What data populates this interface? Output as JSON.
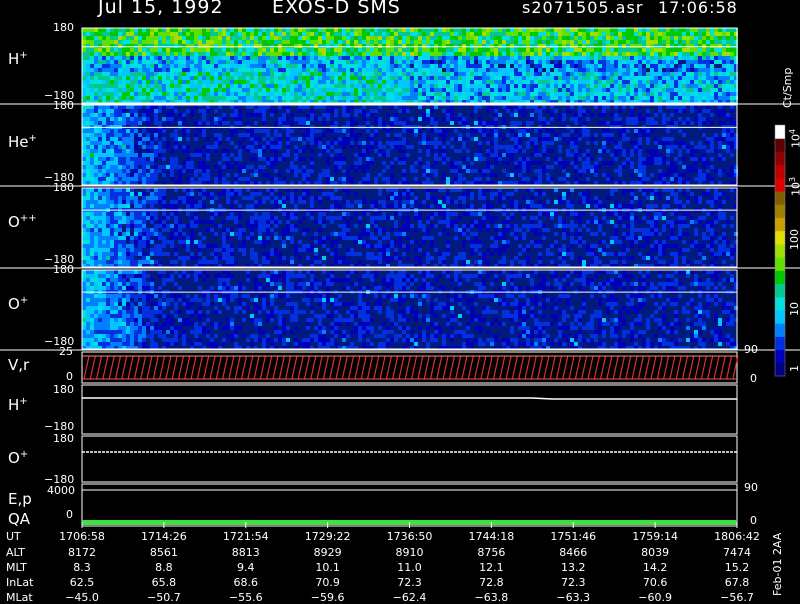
{
  "header": {
    "date": "Jul 15, 1992",
    "instrument": "EXOS-D SMS",
    "file": "s2071505.asr",
    "time": "17:06:58"
  },
  "panels": [
    {
      "label": "H",
      "sup": "+",
      "ymax": "180",
      "ymin": "−180"
    },
    {
      "label": "He",
      "sup": "+",
      "ymax": "180",
      "ymin": "−180"
    },
    {
      "label": "O",
      "sup": "++",
      "ymax": "180",
      "ymin": "−180"
    },
    {
      "label": "O",
      "sup": "+",
      "ymax": "180",
      "ymin": "−180"
    }
  ],
  "vr_panel": {
    "label": "V,r",
    "ymax": "25",
    "ymin": "0",
    "right_max": "90",
    "right_min": "0"
  },
  "line_panels": [
    {
      "label": "H",
      "sup": "+",
      "ymax": "180",
      "ymin": "−180"
    },
    {
      "label": "O",
      "sup": "+",
      "ymax": "180",
      "ymin": "−180"
    }
  ],
  "ep_panel": {
    "label1": "E,p",
    "label2": "QA",
    "ymax": "4000",
    "ymin": "0",
    "right_max": "90",
    "right_min": "0"
  },
  "colorbar": {
    "unit": "Ct/Smp",
    "tick_labels": [
      "1",
      "10",
      "100",
      "10",
      "10"
    ],
    "tick_sups": [
      "",
      "",
      "",
      "3",
      "4"
    ],
    "colors": [
      "#000080",
      "#0000b8",
      "#0030e0",
      "#0080ff",
      "#00c8ff",
      "#00e0e0",
      "#00c890",
      "#00c800",
      "#60e000",
      "#a0e000",
      "#e0e000",
      "#c8a000",
      "#a08000",
      "#806000",
      "#e00000",
      "#c00000",
      "#900000",
      "#600000",
      "#ffffff"
    ]
  },
  "ephemeris": {
    "rows": [
      {
        "name": "UT",
        "values": [
          "1706:58",
          "1714:26",
          "1721:54",
          "1729:22",
          "1736:50",
          "1744:18",
          "1751:46",
          "1759:14",
          "1806:42"
        ]
      },
      {
        "name": "ALT",
        "values": [
          "8172",
          "8561",
          "8813",
          "8929",
          "8910",
          "8756",
          "8466",
          "8039",
          "7474"
        ]
      },
      {
        "name": "MLT",
        "values": [
          "8.3",
          "8.8",
          "9.4",
          "10.1",
          "11.0",
          "12.1",
          "13.2",
          "14.2",
          "15.2"
        ]
      },
      {
        "name": "InLat",
        "values": [
          "62.5",
          "65.8",
          "68.6",
          "70.9",
          "72.3",
          "72.8",
          "72.3",
          "70.6",
          "67.8"
        ]
      },
      {
        "name": "MLat",
        "values": [
          "−45.0",
          "−50.7",
          "−55.6",
          "−59.6",
          "−62.4",
          "−63.8",
          "−63.3",
          "−60.9",
          "−56.7"
        ]
      }
    ]
  },
  "footer_note": "Feb-01 2AA",
  "chart_data": {
    "type": "heatmap",
    "title": "Jul 15, 1992   EXOS-D SMS",
    "x": [
      "1706:58",
      "1714:26",
      "1721:54",
      "1729:22",
      "1736:50",
      "1744:18",
      "1751:46",
      "1759:14",
      "1806:42"
    ],
    "series": [
      {
        "name": "H+",
        "ylim": [
          -180,
          180
        ]
      },
      {
        "name": "He+",
        "ylim": [
          -180,
          180
        ]
      },
      {
        "name": "O++",
        "ylim": [
          -180,
          180
        ]
      },
      {
        "name": "O+",
        "ylim": [
          -180,
          180
        ]
      },
      {
        "name": "V,r",
        "ylim": [
          0,
          25
        ]
      },
      {
        "name": "E,p",
        "ylim": [
          0,
          4000
        ]
      }
    ],
    "color_scale": {
      "unit": "Ct/Smp",
      "range": [
        1,
        10000
      ],
      "log": true
    }
  }
}
